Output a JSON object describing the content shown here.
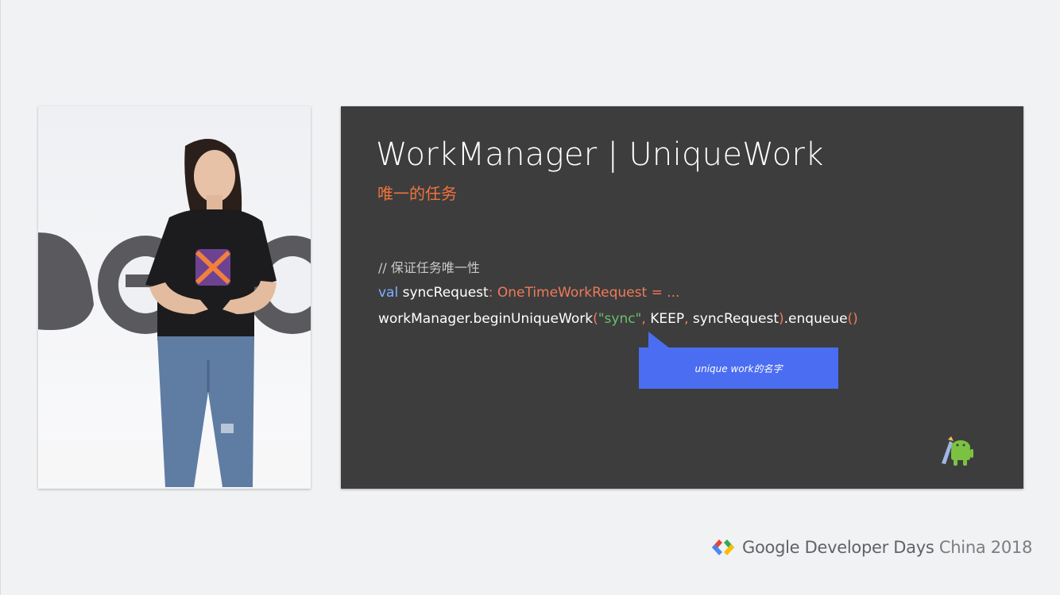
{
  "slide": {
    "title": "WorkManager | UniqueWork",
    "subtitle": "唯一的任务",
    "comment": "// 保证任务唯一性",
    "code_line1": {
      "kw": "val",
      "name": " syncRequest",
      "colon": ":",
      "type": " OneTimeWorkRequest = ..."
    },
    "code_line2": {
      "call": "workManager.beginUniqueWork",
      "open": "(",
      "arg1": "\"sync\"",
      "comma1": ",",
      "arg2": " KEEP",
      "comma2": ",",
      "arg3": " syncRequest",
      "close": ")",
      "method": ".enqueue",
      "parens": "()"
    },
    "callout": "unique work的名字"
  },
  "branding": {
    "name": "Google Developer Days",
    "region": " China 2018"
  },
  "colors": {
    "slide_bg": "#3d3d3e",
    "accent_orange": "#f0733a",
    "callout_blue": "#4b6df2",
    "keyword_blue": "#7fb0ff",
    "string_green": "#6bbf6a"
  }
}
